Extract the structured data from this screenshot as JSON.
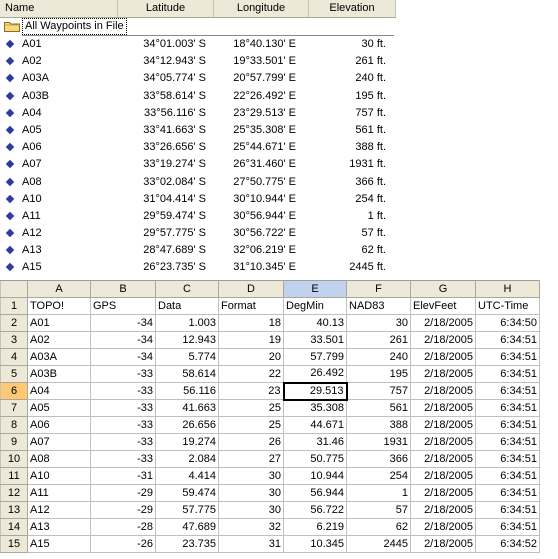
{
  "waypoints": {
    "columns": [
      "Name",
      "Latitude",
      "Longitude",
      "Elevation"
    ],
    "group_label": "All Waypoints in File",
    "rows": [
      {
        "name": "A01",
        "lat": "34°01.003' S",
        "lon": "18°40.130' E",
        "elev": "30 ft."
      },
      {
        "name": "A02",
        "lat": "34°12.943' S",
        "lon": "19°33.501' E",
        "elev": "261 ft."
      },
      {
        "name": "A03A",
        "lat": "34°05.774' S",
        "lon": "20°57.799' E",
        "elev": "240 ft."
      },
      {
        "name": "A03B",
        "lat": "33°58.614' S",
        "lon": "22°26.492' E",
        "elev": "195 ft."
      },
      {
        "name": "A04",
        "lat": "33°56.116' S",
        "lon": "23°29.513' E",
        "elev": "757 ft."
      },
      {
        "name": "A05",
        "lat": "33°41.663' S",
        "lon": "25°35.308' E",
        "elev": "561 ft."
      },
      {
        "name": "A06",
        "lat": "33°26.656' S",
        "lon": "25°44.671' E",
        "elev": "388 ft."
      },
      {
        "name": "A07",
        "lat": "33°19.274' S",
        "lon": "26°31.460' E",
        "elev": "1931 ft."
      },
      {
        "name": "A08",
        "lat": "33°02.084' S",
        "lon": "27°50.775' E",
        "elev": "366 ft."
      },
      {
        "name": "A10",
        "lat": "31°04.414' S",
        "lon": "30°10.944' E",
        "elev": "254 ft."
      },
      {
        "name": "A11",
        "lat": "29°59.474' S",
        "lon": "30°56.944' E",
        "elev": "1 ft."
      },
      {
        "name": "A12",
        "lat": "29°57.775' S",
        "lon": "30°56.722' E",
        "elev": "57 ft."
      },
      {
        "name": "A13",
        "lat": "28°47.689' S",
        "lon": "32°06.219' E",
        "elev": "62 ft."
      },
      {
        "name": "A15",
        "lat": "26°23.735' S",
        "lon": "31°10.345' E",
        "elev": "2445 ft."
      }
    ]
  },
  "sheet": {
    "col_letters": [
      "A",
      "B",
      "C",
      "D",
      "E",
      "F",
      "G",
      "H"
    ],
    "selected_col": "E",
    "selected_row": 6,
    "headers": [
      "TOPO!",
      "GPS",
      "Data",
      "Format",
      "DegMin",
      "NAD83",
      "ElevFeet",
      "UTC-Time"
    ],
    "rows": [
      [
        "A01",
        "-34",
        "1.003",
        "18",
        "40.13",
        "30",
        "2/18/2005",
        "6:34:50"
      ],
      [
        "A02",
        "-34",
        "12.943",
        "19",
        "33.501",
        "261",
        "2/18/2005",
        "6:34:51"
      ],
      [
        "A03A",
        "-34",
        "5.774",
        "20",
        "57.799",
        "240",
        "2/18/2005",
        "6:34:51"
      ],
      [
        "A03B",
        "-33",
        "58.614",
        "22",
        "26.492",
        "195",
        "2/18/2005",
        "6:34:51"
      ],
      [
        "A04",
        "-33",
        "56.116",
        "23",
        "29.513",
        "757",
        "2/18/2005",
        "6:34:51"
      ],
      [
        "A05",
        "-33",
        "41.663",
        "25",
        "35.308",
        "561",
        "2/18/2005",
        "6:34:51"
      ],
      [
        "A06",
        "-33",
        "26.656",
        "25",
        "44.671",
        "388",
        "2/18/2005",
        "6:34:51"
      ],
      [
        "A07",
        "-33",
        "19.274",
        "26",
        "31.46",
        "1931",
        "2/18/2005",
        "6:34:51"
      ],
      [
        "A08",
        "-33",
        "2.084",
        "27",
        "50.775",
        "366",
        "2/18/2005",
        "6:34:51"
      ],
      [
        "A10",
        "-31",
        "4.414",
        "30",
        "10.944",
        "254",
        "2/18/2005",
        "6:34:51"
      ],
      [
        "A11",
        "-29",
        "59.474",
        "30",
        "56.944",
        "1",
        "2/18/2005",
        "6:34:51"
      ],
      [
        "A12",
        "-29",
        "57.775",
        "30",
        "56.722",
        "57",
        "2/18/2005",
        "6:34:51"
      ],
      [
        "A13",
        "-28",
        "47.689",
        "32",
        "6.219",
        "62",
        "2/18/2005",
        "6:34:51"
      ],
      [
        "A15",
        "-26",
        "23.735",
        "31",
        "10.345",
        "2445",
        "2/18/2005",
        "6:34:52"
      ]
    ]
  },
  "icons": {
    "group": "folder-icon",
    "waypoint": "waypoint-diamond-icon"
  },
  "colors": {
    "waypoint_marker": "#2b3c9e",
    "header_bg": "#ece9d8",
    "selected_row_header": "#ffc875",
    "selected_col_header": "#c1d2ee"
  }
}
